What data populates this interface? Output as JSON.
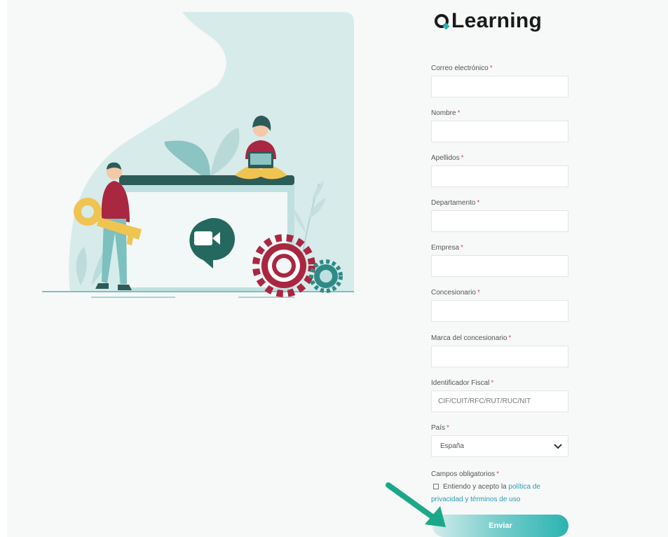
{
  "logo": {
    "text": "Learning"
  },
  "form": {
    "required_mark": "*",
    "fields": [
      {
        "label": "Correo electrónico"
      },
      {
        "label": "Nombre"
      },
      {
        "label": "Apellidos"
      },
      {
        "label": "Departamento"
      },
      {
        "label": "Empresa"
      },
      {
        "label": "Concesionario"
      },
      {
        "label": "Marca del concesionario"
      },
      {
        "label": "Identificador Fiscal",
        "placeholder": "CIF/CUIT/RFC/RUT/RUC/NIT"
      }
    ],
    "country": {
      "label": "País",
      "value": "España"
    },
    "consent": {
      "title": "Campos obligatorios",
      "text": "Entiendo y acepto la",
      "link": "política de privacidad y términos de uso"
    },
    "submit_label": "Enviar"
  },
  "colors": {
    "accent": "#2bb3b1",
    "link": "#2a9cb0",
    "required": "#d9534f",
    "background": "#f7f8f8"
  },
  "icons": [
    "video-camera-icon",
    "gear-icon",
    "key-icon",
    "chevron-down-icon",
    "checkbox-icon",
    "arrow-pointer-icon"
  ]
}
